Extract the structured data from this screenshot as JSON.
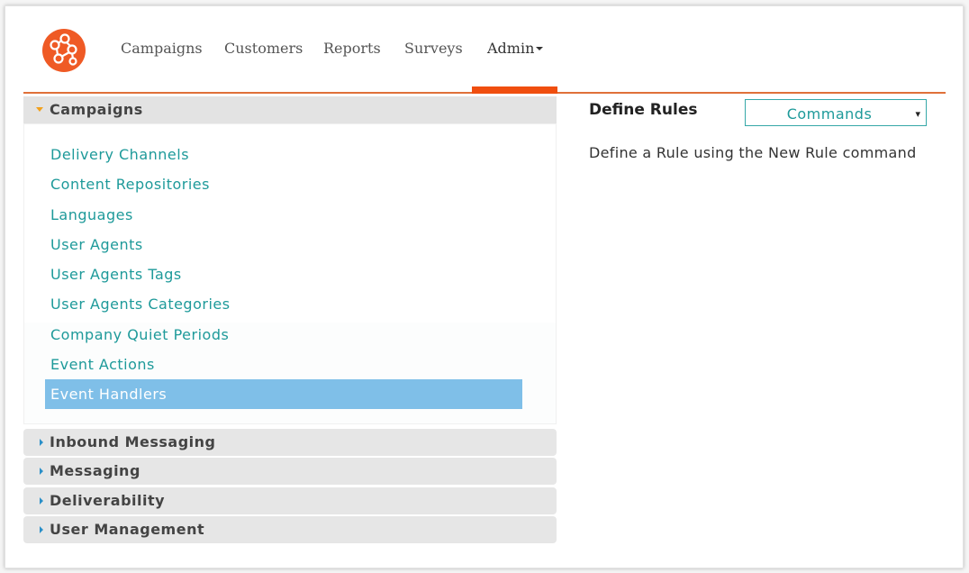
{
  "nav": {
    "items": [
      {
        "label": "Campaigns"
      },
      {
        "label": "Customers"
      },
      {
        "label": "Reports"
      },
      {
        "label": "Surveys"
      },
      {
        "label": "Admin"
      }
    ],
    "active": "Admin"
  },
  "sidebar": {
    "open_section": {
      "label": "Campaigns",
      "items": [
        {
          "label": "Delivery Channels"
        },
        {
          "label": "Content Repositories"
        },
        {
          "label": "Languages"
        },
        {
          "label": "User Agents"
        },
        {
          "label": "User Agents Tags"
        },
        {
          "label": "User Agents Categories"
        },
        {
          "label": "Company Quiet Periods"
        },
        {
          "label": "Event Actions"
        },
        {
          "label": "Event Handlers"
        }
      ],
      "selected": "Event Handlers"
    },
    "collapsed_sections": [
      {
        "label": "Inbound Messaging"
      },
      {
        "label": "Messaging"
      },
      {
        "label": "Deliverability"
      },
      {
        "label": "User Management"
      }
    ]
  },
  "main": {
    "title": "Define Rules",
    "commands_label": "Commands",
    "commands_arrow": "▾",
    "hint": "Define a Rule using the New Rule command"
  },
  "colors": {
    "accent": "#f04e0f",
    "link": "#1e9a9a",
    "selected_bg": "#7fbfe8"
  }
}
